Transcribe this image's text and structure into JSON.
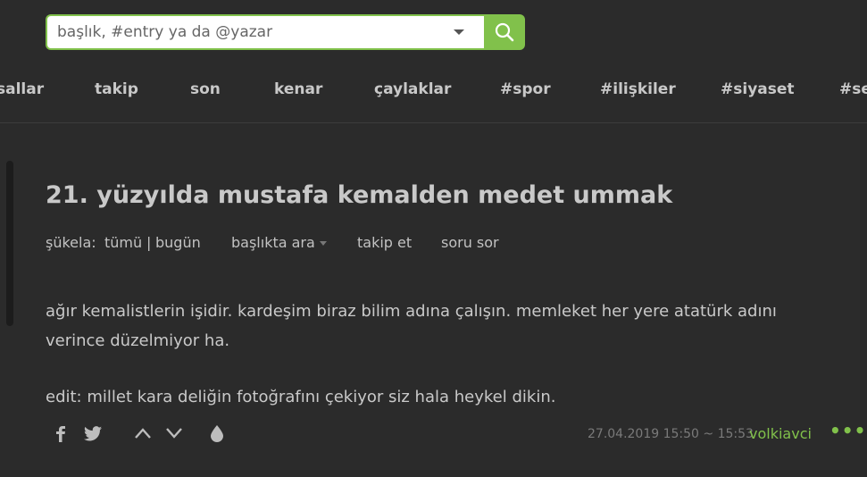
{
  "search": {
    "placeholder": "başlık, #entry ya da @yazar"
  },
  "nav": {
    "items": [
      {
        "label": "sallar"
      },
      {
        "label": "takip"
      },
      {
        "label": "son"
      },
      {
        "label": "kenar"
      },
      {
        "label": "çaylaklar"
      },
      {
        "label": "#spor"
      },
      {
        "label": "#ilişkiler"
      },
      {
        "label": "#siyaset"
      },
      {
        "label": "#sey"
      }
    ]
  },
  "topic": {
    "title": "21. yüzyılda mustafa kemalden medet ummak",
    "sukela_label": "şükela:",
    "sukela_all": "tümü",
    "sukela_sep": "|",
    "sukela_today": "bugün",
    "search_in_topic": "başlıkta ara",
    "follow": "takip et",
    "ask": "soru sor"
  },
  "entry": {
    "line1": "ağır kemalistlerin işidir. kardeşim biraz bilim adına çalışın. memleket her yere atatürk adını",
    "line2": "verince düzelmiyor ha.",
    "edit": "edit: millet kara deliğin fotoğrafını çekiyor siz hala heykel dikin.",
    "date": "27.04.2019 15:50 ~ 15:53",
    "author": "volkiavci",
    "more": "•••"
  },
  "colors": {
    "accent": "#81c14b",
    "background": "#2b2b2b",
    "text": "#c9c9c9",
    "muted": "#7a7a7a"
  },
  "icons": [
    "search-icon",
    "facebook-icon",
    "twitter-icon",
    "upvote-icon",
    "downvote-icon",
    "favorite-drop-icon",
    "more-icon"
  ]
}
